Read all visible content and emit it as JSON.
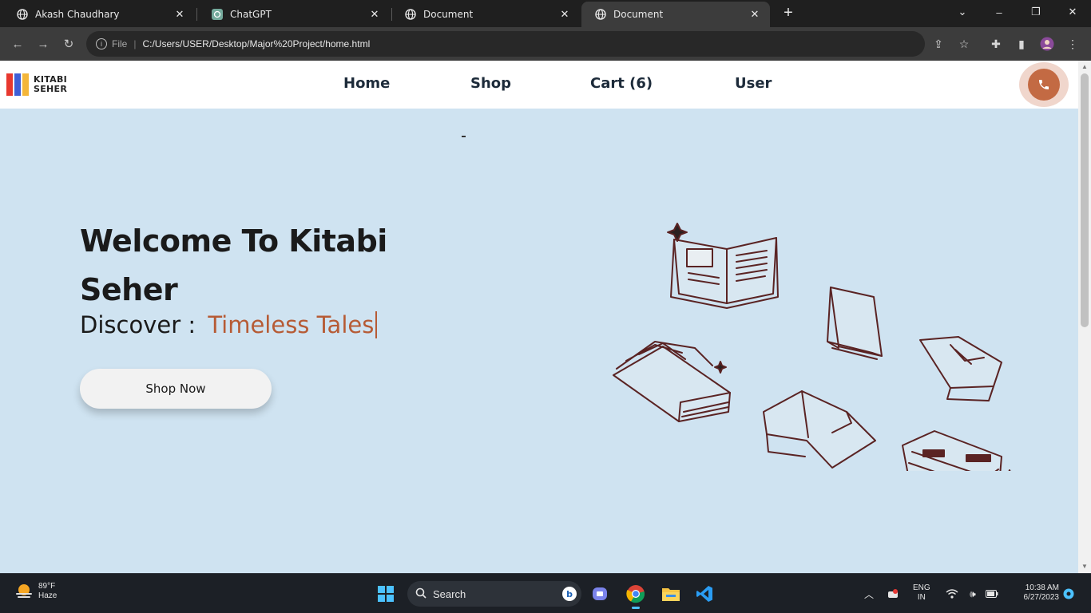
{
  "browser": {
    "tabs": [
      {
        "title": "Akash Chaudhary",
        "icon": "globe-icon",
        "active": false
      },
      {
        "title": "ChatGPT",
        "icon": "chatgpt-icon",
        "active": false
      },
      {
        "title": "Document",
        "icon": "globe-icon",
        "active": false
      },
      {
        "title": "Document",
        "icon": "globe-icon",
        "active": true
      }
    ],
    "new_tab": "+",
    "address": {
      "scheme": "File",
      "url": "C:/Users/USER/Desktop/Major%20Project/home.html"
    }
  },
  "site": {
    "logo": {
      "line1": "KITABI",
      "line2": "SEHER",
      "colors": [
        "#e8382e",
        "#3f5fd6",
        "#f4b63a"
      ]
    },
    "nav": {
      "home": "Home",
      "shop": "Shop",
      "cart": "Cart (6)",
      "user": "User"
    },
    "accent_color": "#c36a43"
  },
  "hero": {
    "title": "Welcome To Kitabi Seher",
    "discover_label": "Discover :",
    "discover_value": "Timeless Tales",
    "button_label": "Shop Now"
  },
  "taskbar": {
    "weather": {
      "temp": "89°F",
      "condition": "Haze"
    },
    "search_label": "Search",
    "language": {
      "line1": "ENG",
      "line2": "IN"
    },
    "clock": {
      "time": "10:38 AM",
      "date": "6/27/2023"
    }
  }
}
